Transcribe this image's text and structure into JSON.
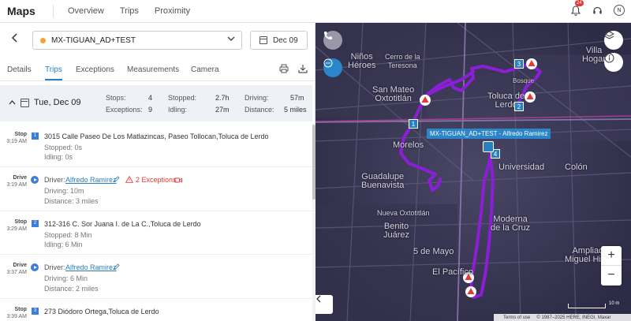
{
  "app": {
    "title": "Maps"
  },
  "nav": {
    "items": [
      "Overview",
      "Trips",
      "Proximity"
    ]
  },
  "header": {
    "notification_count": "24",
    "avatar_initial": "N"
  },
  "vehicle": {
    "name": "MX-TIGUAN_AD+TEST",
    "status_color": "#f0a23b",
    "date": "Dec 09"
  },
  "tabs": [
    "Details",
    "Trips",
    "Exceptions",
    "Measurements",
    "Camera"
  ],
  "day": {
    "title": "Tue, Dec 09",
    "stops_label": "Stops:",
    "stops": "4",
    "exceptions_label": "Exceptions:",
    "exceptions": "9",
    "stopped_label": "Stopped:",
    "stopped": "2.7h",
    "idling_label": "Idling:",
    "idling": "27m",
    "driving_label": "Driving:",
    "driving": "57m",
    "distance_label": "Distance:",
    "distance": "5 miles"
  },
  "list": [
    {
      "kind": "Stop",
      "time": "3:19 AM",
      "num": "1",
      "address": "3015 Calle Paseo De Los Matlazincas, Paseo Tollocan,Toluca de Lerdo",
      "line1": "Stopped: 0s",
      "line2": "Idling: 0s"
    },
    {
      "kind": "Drive",
      "time": "3:19 AM",
      "driver_label": "Driver:",
      "driver": "Alfredo Ramirez",
      "exceptions": "2 Exceptions",
      "line1": "Driving: 10m",
      "line2": "Distance: 3 miles"
    },
    {
      "kind": "Stop",
      "time": "3:29 AM",
      "num": "2",
      "address": "312-316 C. Sor Juana I. de La C.,Toluca de Lerdo",
      "line1": "Stopped: 8 Min",
      "line2": "Idling: 6 Min"
    },
    {
      "kind": "Drive",
      "time": "3:37 AM",
      "driver_label": "Driver:",
      "driver": "Alfredo Ramirez",
      "line1": "Driving: 6 Min",
      "line2": "Distance: 2 miles"
    },
    {
      "kind": "Stop",
      "time": "3:39 AM",
      "num": "3",
      "address": "273 Diódoro Ortega,Toluca de Lerdo"
    }
  ],
  "map": {
    "labels": [
      {
        "text": "Niños\nHéroes",
        "cls": "l1"
      },
      {
        "text": "Cerro de la\nTeresona",
        "cls": "l2"
      },
      {
        "text": "Villa\nHogar",
        "cls": "l3"
      },
      {
        "text": "San Mateo\nOxtotitlán",
        "cls": "l4"
      },
      {
        "text": "Toluca de\nLerdo",
        "cls": "l5"
      },
      {
        "text": "Morelos",
        "cls": "l6"
      },
      {
        "text": "Universidad",
        "cls": "l7"
      },
      {
        "text": "Guadalupe\nBuenavista",
        "cls": "l8"
      },
      {
        "text": "Colón",
        "cls": "l9"
      },
      {
        "text": "Moderna\nde la Cruz",
        "cls": "l10"
      },
      {
        "text": "Nueva Oxtotitlán",
        "cls": "l11"
      },
      {
        "text": "Benito\nJuárez",
        "cls": "l12"
      },
      {
        "text": "5 de Mayo",
        "cls": "l13"
      },
      {
        "text": "El Pacífico",
        "cls": "l14"
      },
      {
        "text": "Ampliación\nMiguel Hidalgo",
        "cls": "l15"
      },
      {
        "text": "Bosque",
        "cls": "l16"
      }
    ],
    "vehicle_label": "MX-TIGUAN_AD+TEST - Alfredo Ramirez",
    "markers": [
      "1",
      "2",
      "3",
      "4"
    ],
    "scale": "10 m",
    "footer_terms": "Terms of use",
    "footer_copy": "© 1987–2025 HERE, INEGI, Maxar",
    "route_color": "#8a1fd6",
    "zoom_in": "+",
    "zoom_out": "−"
  }
}
